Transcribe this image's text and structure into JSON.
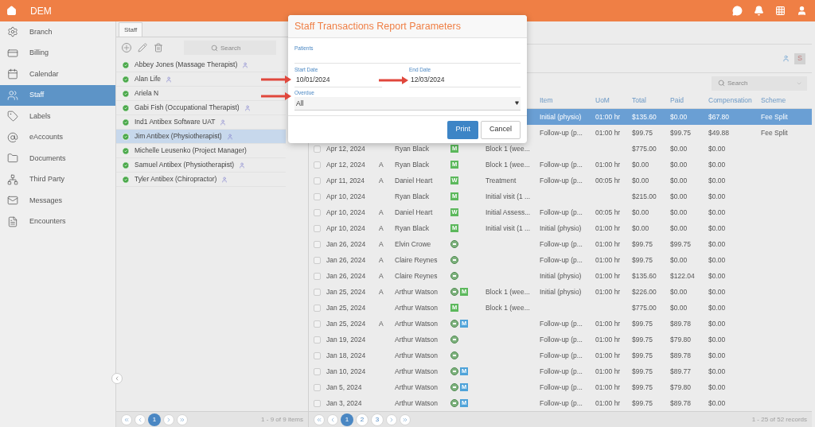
{
  "app": {
    "title": "DEM"
  },
  "sidebar": {
    "items": [
      {
        "label": "Branch",
        "selected": false
      },
      {
        "label": "Billing",
        "selected": false
      },
      {
        "label": "Calendar",
        "selected": false
      },
      {
        "label": "Staff",
        "selected": true
      },
      {
        "label": "Labels",
        "selected": false
      },
      {
        "label": "eAccounts",
        "selected": false
      },
      {
        "label": "Documents",
        "selected": false
      },
      {
        "label": "Third Party",
        "selected": false
      },
      {
        "label": "Messages",
        "selected": false
      },
      {
        "label": "Encounters",
        "selected": false
      }
    ]
  },
  "staff_panel": {
    "tab": {
      "label": "Staff",
      "selected": true
    },
    "search": {
      "placeholder": "Search"
    },
    "items": [
      {
        "name": "Abbey Jones (Massage Therapist)",
        "active": true,
        "user_linked": true,
        "selected": false
      },
      {
        "name": "Alan Life",
        "active": true,
        "user_linked": true,
        "selected": false
      },
      {
        "name": "Ariela N",
        "active": true,
        "user_linked": false,
        "selected": false
      },
      {
        "name": "Gabi Fish (Occupational Therapist)",
        "active": true,
        "user_linked": true,
        "selected": false
      },
      {
        "name": "Ind1 Antibex Software UAT",
        "active": true,
        "user_linked": true,
        "selected": false
      },
      {
        "name": "Jim Antibex (Physiotherapist)",
        "active": true,
        "user_linked": true,
        "selected": true
      },
      {
        "name": "Michelle Leusenko (Project Manager)",
        "active": true,
        "user_linked": false,
        "selected": false
      },
      {
        "name": "Samuel Antibex (Physiotherapist)",
        "active": true,
        "user_linked": true,
        "selected": false
      },
      {
        "name": "Tyler Antibex (Chiropractor)",
        "active": true,
        "user_linked": true,
        "selected": false
      }
    ],
    "pager": {
      "pages": [
        {
          "label": "1",
          "selected": true
        }
      ],
      "summary": "1 - 9 of 9 items"
    }
  },
  "transactions": {
    "badge": "S",
    "search": {
      "placeholder": "Search"
    },
    "columns": [
      "",
      "",
      "",
      "",
      "",
      "",
      "Item",
      "UoM",
      "Total",
      "Paid",
      "Compensation",
      "Scheme"
    ],
    "rows": [
      {
        "item": "Initial (physio)",
        "uom": "01:00 hr",
        "total": "$135.60",
        "paid": "$0.00",
        "compensation": "$67.80",
        "scheme": "Fee Split",
        "selected": true,
        "badges": []
      },
      {
        "item": "Follow-up (p...",
        "uom": "01:00 hr",
        "total": "$99.75",
        "paid": "$99.75",
        "compensation": "$49.88",
        "scheme": "Fee Split",
        "selected": false,
        "badges": []
      },
      {
        "date": "Apr 12, 2024",
        "patient": "Ryan Black",
        "badges": [
          {
            "kind": "letter",
            "text": "M",
            "color": "#5cb85c"
          }
        ],
        "description": "Block 1 (wee...",
        "total": "$775.00",
        "paid": "$0.00",
        "compensation": "$0.00",
        "selected": false
      },
      {
        "date": "Apr 12, 2024",
        "flag": "A",
        "patient": "Ryan Black",
        "badges": [
          {
            "kind": "letter",
            "text": "M",
            "color": "#5cb85c"
          }
        ],
        "description": "Block 1 (wee...",
        "item": "Follow-up (p...",
        "uom": "01:00 hr",
        "total": "$0.00",
        "paid": "$0.00",
        "compensation": "$0.00",
        "selected": false
      },
      {
        "date": "Apr 11, 2024",
        "flag": "A",
        "patient": "Daniel Heart",
        "badges": [
          {
            "kind": "letter",
            "text": "W",
            "color": "#5cb85c"
          }
        ],
        "description": "Treatment",
        "item": "Follow-up (p...",
        "uom": "00:05 hr",
        "total": "$0.00",
        "paid": "$0.00",
        "compensation": "$0.00",
        "selected": false
      },
      {
        "date": "Apr 10, 2024",
        "patient": "Ryan Black",
        "badges": [
          {
            "kind": "letter",
            "text": "M",
            "color": "#5cb85c"
          }
        ],
        "description": "Initial visit (1 ...",
        "total": "$215.00",
        "paid": "$0.00",
        "compensation": "$0.00",
        "selected": false
      },
      {
        "date": "Apr 10, 2024",
        "flag": "A",
        "patient": "Daniel Heart",
        "badges": [
          {
            "kind": "letter",
            "text": "W",
            "color": "#5cb85c"
          }
        ],
        "description": "Initial Assess...",
        "item": "Follow-up (p...",
        "uom": "00:05 hr",
        "total": "$0.00",
        "paid": "$0.00",
        "compensation": "$0.00",
        "selected": false
      },
      {
        "date": "Apr 10, 2024",
        "flag": "A",
        "patient": "Ryan Black",
        "badges": [
          {
            "kind": "letter",
            "text": "M",
            "color": "#5cb85c"
          }
        ],
        "description": "Initial visit (1 ...",
        "item": "Initial (physio)",
        "uom": "01:00 hr",
        "total": "$0.00",
        "paid": "$0.00",
        "compensation": "$0.00",
        "selected": false
      },
      {
        "date": "Jan 26, 2024",
        "flag": "A",
        "patient": "Elvin Crowe",
        "badges": [
          {
            "kind": "circle"
          }
        ],
        "item": "Follow-up (p...",
        "uom": "01:00 hr",
        "total": "$99.75",
        "paid": "$99.75",
        "compensation": "$0.00",
        "selected": false
      },
      {
        "date": "Jan 26, 2024",
        "flag": "A",
        "patient": "Claire Reynes",
        "badges": [
          {
            "kind": "circle"
          }
        ],
        "item": "Follow-up (p...",
        "uom": "01:00 hr",
        "total": "$99.75",
        "paid": "$0.00",
        "compensation": "$0.00",
        "selected": false
      },
      {
        "date": "Jan 26, 2024",
        "flag": "A",
        "patient": "Claire Reynes",
        "badges": [
          {
            "kind": "circle"
          }
        ],
        "item": "Initial (physio)",
        "uom": "01:00 hr",
        "total": "$135.60",
        "paid": "$122.04",
        "compensation": "$0.00",
        "selected": false
      },
      {
        "date": "Jan 25, 2024",
        "flag": "A",
        "patient": "Arthur Watson",
        "badges": [
          {
            "kind": "circle"
          },
          {
            "kind": "letter",
            "text": "M",
            "color": "#5cb85c"
          }
        ],
        "description": "Block 1 (wee...",
        "item": "Initial (physio)",
        "uom": "01:00 hr",
        "total": "$226.00",
        "paid": "$0.00",
        "compensation": "$0.00",
        "selected": false
      },
      {
        "date": "Jan 25, 2024",
        "patient": "Arthur Watson",
        "badges": [
          {
            "kind": "letter",
            "text": "M",
            "color": "#5cb85c"
          }
        ],
        "description": "Block 1 (wee...",
        "total": "$775.00",
        "paid": "$0.00",
        "compensation": "$0.00",
        "selected": false
      },
      {
        "date": "Jan 25, 2024",
        "flag": "A",
        "patient": "Arthur Watson",
        "badges": [
          {
            "kind": "circle"
          },
          {
            "kind": "letter",
            "text": "M",
            "color": "#4fa3d9"
          }
        ],
        "item": "Follow-up (p...",
        "uom": "01:00 hr",
        "total": "$99.75",
        "paid": "$89.78",
        "compensation": "$0.00",
        "selected": false
      },
      {
        "date": "Jan 19, 2024",
        "patient": "Arthur Watson",
        "badges": [
          {
            "kind": "circle"
          }
        ],
        "item": "Follow-up (p...",
        "uom": "01:00 hr",
        "total": "$99.75",
        "paid": "$79.80",
        "compensation": "$0.00",
        "selected": false
      },
      {
        "date": "Jan 18, 2024",
        "patient": "Arthur Watson",
        "badges": [
          {
            "kind": "circle"
          }
        ],
        "item": "Follow-up (p...",
        "uom": "01:00 hr",
        "total": "$99.75",
        "paid": "$89.78",
        "compensation": "$0.00",
        "selected": false
      },
      {
        "date": "Jan 10, 2024",
        "patient": "Arthur Watson",
        "badges": [
          {
            "kind": "circle"
          },
          {
            "kind": "letter",
            "text": "M",
            "color": "#4fa3d9"
          }
        ],
        "item": "Follow-up (p...",
        "uom": "01:00 hr",
        "total": "$99.75",
        "paid": "$89.77",
        "compensation": "$0.00",
        "selected": false
      },
      {
        "date": "Jan 5, 2024",
        "patient": "Arthur Watson",
        "badges": [
          {
            "kind": "circle"
          },
          {
            "kind": "letter",
            "text": "M",
            "color": "#4fa3d9"
          }
        ],
        "item": "Follow-up (p...",
        "uom": "01:00 hr",
        "total": "$99.75",
        "paid": "$79.80",
        "compensation": "$0.00",
        "selected": false
      },
      {
        "date": "Jan 3, 2024",
        "patient": "Arthur Watson",
        "badges": [
          {
            "kind": "circle"
          },
          {
            "kind": "letter",
            "text": "M",
            "color": "#4fa3d9"
          }
        ],
        "item": "Follow-up (p...",
        "uom": "01:00 hr",
        "total": "$99.75",
        "paid": "$89.78",
        "compensation": "$0.00",
        "selected": false
      }
    ],
    "pager": {
      "pages": [
        {
          "label": "1",
          "selected": true
        },
        {
          "label": "2",
          "selected": false
        },
        {
          "label": "3",
          "selected": false
        }
      ],
      "summary": "1 - 25 of 52 records"
    }
  },
  "dialog": {
    "title": "Staff Transactions Report Parameters",
    "patients": {
      "label": "Patients"
    },
    "start_date": {
      "label": "Start Date",
      "value": "10/01/2024"
    },
    "end_date": {
      "label": "End Date",
      "value": "12/03/2024"
    },
    "overdue": {
      "label": "Overdue",
      "value": "All"
    },
    "buttons": [
      {
        "label": "Print",
        "kind": "primary"
      },
      {
        "label": "Cancel",
        "kind": "secondary"
      }
    ]
  }
}
